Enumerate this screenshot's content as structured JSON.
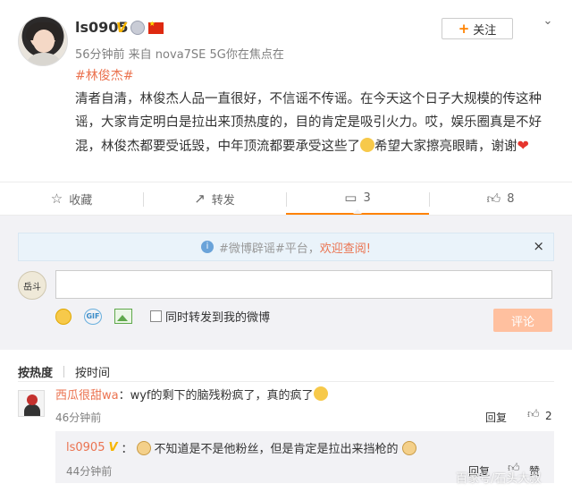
{
  "post": {
    "username": "ls0905",
    "vip_badge": "V",
    "meta": "56分钟前  来自 nova7SE 5G你在焦点在",
    "follow_label": "关注",
    "follow_plus": "+",
    "chevron": "⌄",
    "topic": "#林俊杰#",
    "content_parts": {
      "text": "清者自清，林俊杰人品一直很好，不信谣不传谣。在今天这个日子大规模的传这种谣，大家肯定明白是拉出来顶热度的，目的肯定是吸引火力。哎，娱乐圈真是不好混，林俊杰都要受诋毁，中年顶流都要承受这些了",
      "after_emoji": "希望大家擦亮眼睛，谢谢"
    },
    "heart": "❤"
  },
  "actions": {
    "favorite": {
      "label": "收藏",
      "icon": "star-outline-icon"
    },
    "repost": {
      "label": "转发",
      "icon": "repost-icon"
    },
    "comment": {
      "label": "3",
      "icon": "comment-icon"
    },
    "like": {
      "label": "8",
      "icon": "thumbs-up-icon"
    }
  },
  "comment_panel": {
    "notice_prefix": "#微博辟谣#平台，",
    "notice_link": "欢迎查阅!",
    "notice_close": "×",
    "avatar_text": "岳斗",
    "repost_label": "同时转发到我的微博",
    "submit_label": "评论"
  },
  "sort": {
    "hot": "按热度",
    "time": "按时间"
  },
  "comments": [
    {
      "name": "西瓜很甜wa",
      "text": "：wyf的剩下的脑残粉疯了，真的疯了",
      "time": "46分钟前",
      "reply": "回复",
      "likes": "2"
    },
    {
      "name": "ls0905",
      "badge": "V",
      "text_before": "：",
      "text_mid": "不知道是不是他粉丝，但是肯定是拉出来挡枪的",
      "time": "44分钟前",
      "reply": "回复",
      "like_label": "赞"
    }
  ],
  "watermark": "百家号/石头大叔",
  "colors": {
    "accent": "#ff8200",
    "link": "#eb7350",
    "panel_bg": "#f2f2f5",
    "notice_bg": "#eaf3fa"
  }
}
